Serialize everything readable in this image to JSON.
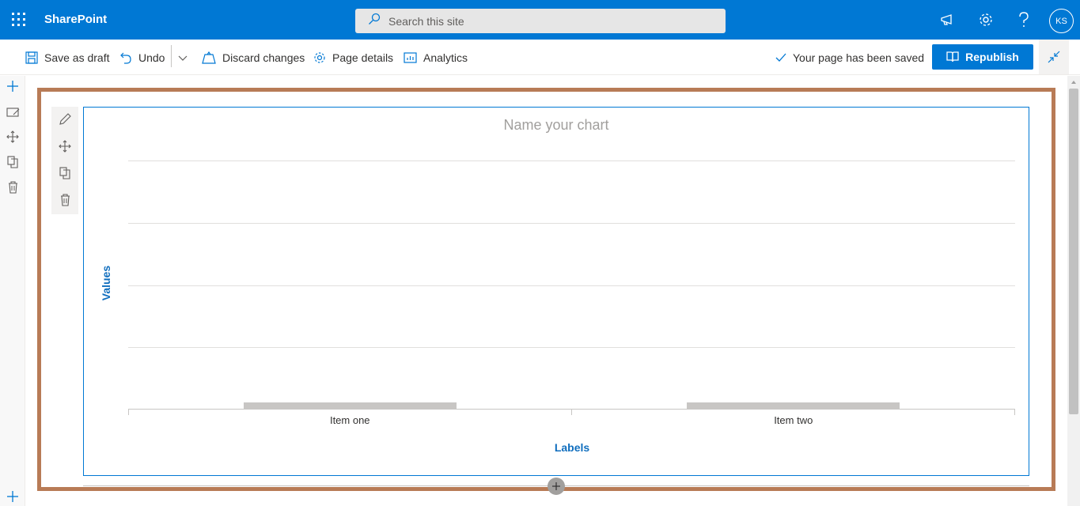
{
  "suite": {
    "app_name": "SharePoint",
    "search_placeholder": "Search this site",
    "avatar_initials": "KS",
    "brand_color": "#0078d4"
  },
  "commands": {
    "save_draft": "Save as draft",
    "undo": "Undo",
    "discard": "Discard changes",
    "page_details": "Page details",
    "analytics": "Analytics",
    "saved_status": "Your page has been saved",
    "republish": "Republish"
  },
  "chart_data": {
    "type": "bar",
    "title": "Name your chart",
    "categories": [
      "Item one",
      "Item two"
    ],
    "values": [
      0,
      0
    ],
    "xlabel": "Labels",
    "ylabel": "Values",
    "grid": true
  }
}
